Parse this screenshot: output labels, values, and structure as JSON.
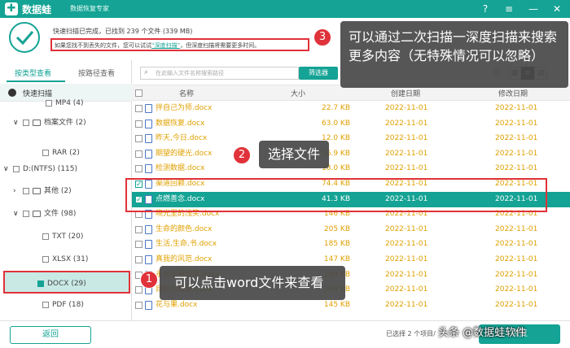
{
  "app": {
    "name": "数据蛙",
    "tagline": "数据恢复专家",
    "logo_char": "✚"
  },
  "titlebar_buttons": [
    {
      "icon": "help-icon",
      "glyph": "?"
    },
    {
      "icon": "menu-icon",
      "glyph": "≡"
    },
    {
      "icon": "minimize-icon",
      "glyph": "—"
    },
    {
      "icon": "close-icon",
      "glyph": "✕"
    }
  ],
  "status": {
    "line": "快速扫描已完成，已找到 239 个文件 (339 MB)",
    "hint_pre": "如果您找不到丢失的文件，您可以试试",
    "hint_link": "“深度扫描”",
    "hint_post": "，但深度扫描将需要更多时间。"
  },
  "left": {
    "tabs": [
      "按类型查看",
      "按路径查看"
    ],
    "quick_scan": "快速扫描",
    "tree": [
      {
        "label": "MP4 (4)",
        "chev": "",
        "checkbox": true,
        "folder": false
      },
      {
        "label": "档案文件 (2)",
        "chev": "∨",
        "checkbox": true,
        "folder": true
      },
      {
        "label": "RAR (2)",
        "chev": "",
        "checkbox": true,
        "folder": false
      },
      {
        "label": "D:(NTFS) (115)",
        "chev": "∨",
        "checkbox": true,
        "folder": false
      },
      {
        "label": "其他 (2)",
        "chev": "›",
        "checkbox": true,
        "folder": true
      },
      {
        "label": "文件 (98)",
        "chev": "∨",
        "checkbox": true,
        "folder": true
      },
      {
        "label": "TXT (20)",
        "chev": "",
        "checkbox": true,
        "folder": false
      },
      {
        "label": "XLSX (31)",
        "chev": "",
        "checkbox": true,
        "folder": false
      },
      {
        "label": "DOCX (29)",
        "chev": "",
        "checkbox": true,
        "folder": false
      },
      {
        "label": "PDF (18)",
        "chev": "",
        "checkbox": true,
        "folder": false
      }
    ]
  },
  "right": {
    "search_placeholder": "在此输入文件名称搜索路径",
    "filter_label": "筛选器",
    "view_icons": [
      "◎",
      "▦",
      "≡",
      "▤"
    ],
    "columns": {
      "name": "名称",
      "size": "大小",
      "created": "创建日期",
      "modified": "修改日期"
    },
    "rows": [
      {
        "name": "拌自己为师.docx",
        "size": "22.7 KB",
        "created": "2022-11-01",
        "modified": "2022-11-01",
        "state": ""
      },
      {
        "name": "数据恢复.docx",
        "size": "63.0 KB",
        "created": "2022-11-01",
        "modified": "2022-11-01",
        "state": ""
      },
      {
        "name": "昨天,今日.docx",
        "size": "12.0 KB",
        "created": "2022-11-01",
        "modified": "2022-11-01",
        "state": ""
      },
      {
        "name": "期望的硬光.docx",
        "size": "16.9 KB",
        "created": "2022-11-01",
        "modified": "2022-11-01",
        "state": ""
      },
      {
        "name": "检测数据.docx",
        "size": "18.0 KB",
        "created": "2022-11-01",
        "modified": "2022-11-01",
        "state": ""
      },
      {
        "name": "渠道回赖.docx",
        "size": "74.4 KB",
        "created": "2022-11-01",
        "modified": "2022-11-01",
        "state": "checked"
      },
      {
        "name": "点燃善念.docx",
        "size": "41.3 KB",
        "created": "2022-11-01",
        "modified": "2022-11-01",
        "state": "sel"
      },
      {
        "name": "晓光里的浅笑.docx",
        "size": "146 KB",
        "created": "2022-11-01",
        "modified": "2022-11-01",
        "state": ""
      },
      {
        "name": "生命的颜色.docx",
        "size": "205 KB",
        "created": "2022-11-01",
        "modified": "2022-11-01",
        "state": ""
      },
      {
        "name": "生活,生命,书.docx",
        "size": "185 KB",
        "created": "2022-11-01",
        "modified": "2022-11-01",
        "state": ""
      },
      {
        "name": "真我的风范.docx",
        "size": "147 KB",
        "created": "2022-11-01",
        "modified": "2022-11-01",
        "state": ""
      },
      {
        "name": "永远不要放弃.docx",
        "size": "148 KB",
        "created": "2022-11-01",
        "modified": "2022-11-01",
        "state": ""
      },
      {
        "name": "目标与理想.docx",
        "size": "144 KB",
        "created": "2022-11-01",
        "modified": "2022-11-01",
        "state": ""
      },
      {
        "name": "花与果.docx",
        "size": "145 KB",
        "created": "2022-11-01",
        "modified": "2022-11-01",
        "state": ""
      }
    ]
  },
  "bottom": {
    "back_label": "返回",
    "selected_text": "已选择 2 个项目/",
    "recover_label": "恢复"
  },
  "callouts": [
    {
      "num": "3",
      "text": "可以通过二次扫描一深度扫描来搜索更多内容（无特殊情况可以忽略）"
    },
    {
      "num": "2",
      "text": "选择文件"
    },
    {
      "num": "1",
      "text": "可以点击word文件来查看"
    }
  ],
  "watermark": "头条 @数据蛙软件",
  "colors": {
    "accent": "#14a394",
    "highlight": "#e0323a",
    "file_text": "#e0a000"
  }
}
